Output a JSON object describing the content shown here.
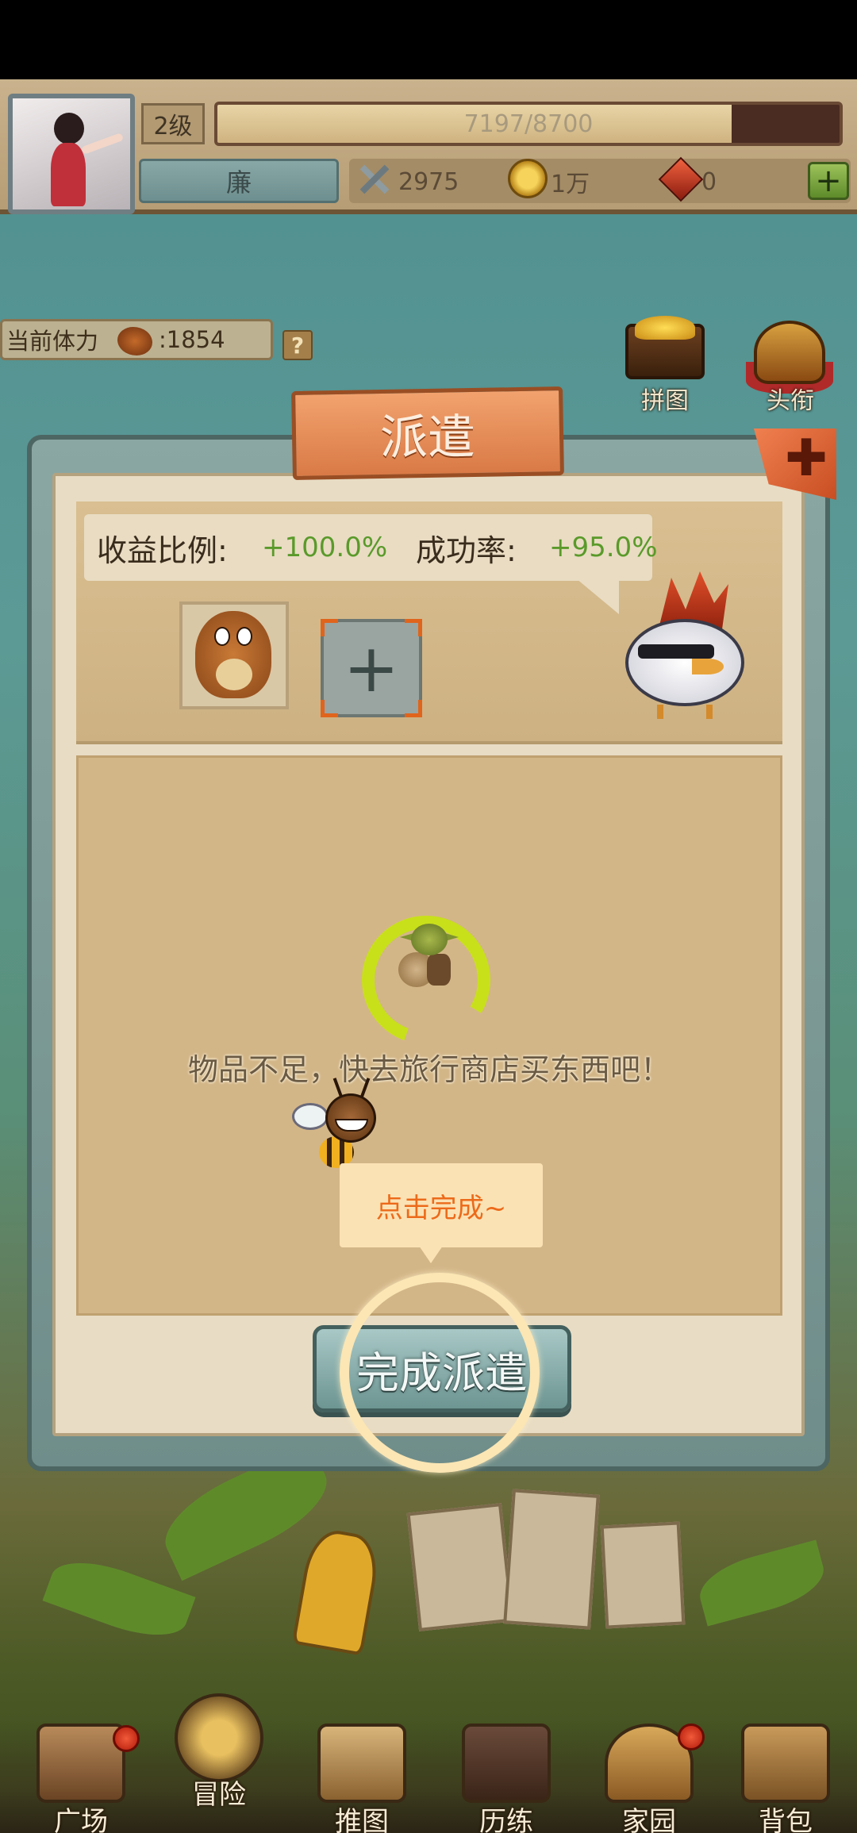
{
  "hud": {
    "level": "2级",
    "exp_text": "7197/8700",
    "exp_progress": 0.827,
    "player_name": "廉",
    "power": "2975",
    "coins": "1万",
    "gems": "0",
    "add_button": "+"
  },
  "stamina": {
    "label": "当前体力",
    "value": ":1854",
    "help": "?"
  },
  "corner_buttons": {
    "puzzle": "拼图",
    "title": "头衔"
  },
  "dialog": {
    "title": "派遣",
    "close_icon": "✚",
    "income_label": "收益比例:",
    "income_value": "+100.0%",
    "success_label": "成功率:",
    "success_value": "+95.0%",
    "add_slot_icon": "+",
    "message": "物品不足，快去旅行商店买东西吧！",
    "tooltip": "点击完成~",
    "complete_button": "完成派遣",
    "loader_progress": 0.78
  },
  "nav": {
    "plaza": "广场",
    "adventure": "冒险",
    "map": "推图",
    "training": "历练",
    "home": "家园",
    "bag": "背包"
  },
  "colors": {
    "accent_green": "#5a9a2a",
    "tooltip_orange": "#ec6a1a",
    "title_plank": "#d97a46",
    "badge_red": "#d8321a"
  }
}
